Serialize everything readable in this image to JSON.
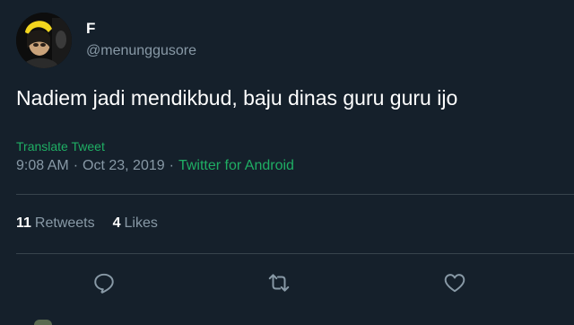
{
  "user": {
    "display_name": "F",
    "handle": "@menunggusore"
  },
  "tweet": {
    "text": "Nadiem jadi mendikbud, baju dinas guru guru ijo",
    "translate_label": "Translate Tweet",
    "time": "9:08 AM",
    "separator": "·",
    "date": "Oct 23, 2019",
    "source": "Twitter for Android"
  },
  "stats": {
    "retweets_count": "11",
    "retweets_label": "Retweets",
    "likes_count": "4",
    "likes_label": "Likes"
  },
  "actions": {
    "reply_icon": "reply-icon",
    "retweet_icon": "retweet-icon",
    "like_icon": "heart-icon"
  },
  "colors": {
    "background": "#15202b",
    "secondary_text": "#8899a6",
    "link_green": "#1fae64",
    "divider": "#38444d"
  }
}
